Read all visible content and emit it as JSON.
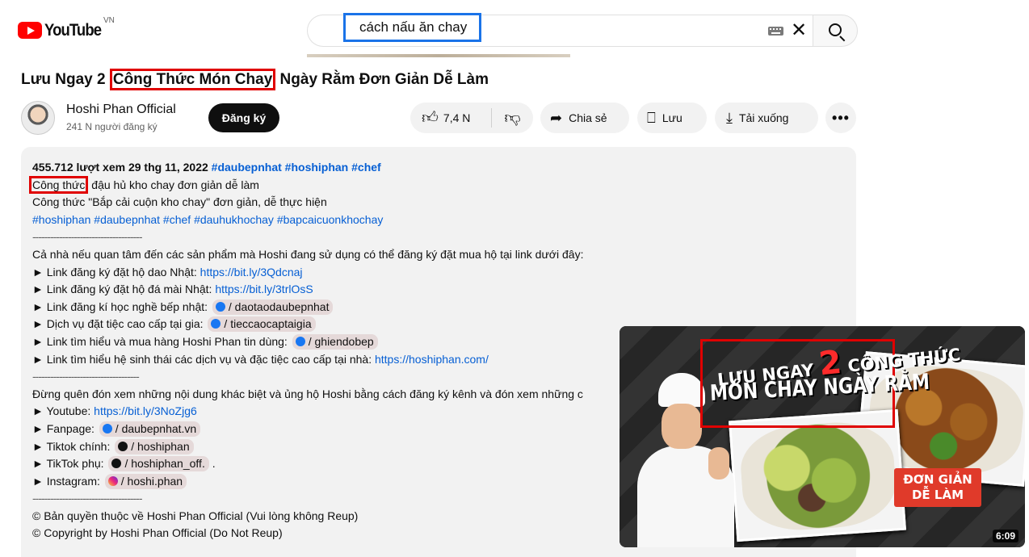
{
  "header": {
    "logo_text": "YouTube",
    "country_code": "VN",
    "search_value": "cách nấu ăn chay"
  },
  "video": {
    "title_prefix": "Lưu Ngay 2 ",
    "title_highlight": "Công Thức Món Chay",
    "title_suffix": " Ngày Rằm Đơn Giản Dễ Làm"
  },
  "channel": {
    "name": "Hoshi Phan Official",
    "subscribers": "241 N người đăng ký",
    "subscribe_label": "Đăng ký"
  },
  "actions": {
    "likes": "7,4 N",
    "share_label": "Chia sẻ",
    "save_label": "Lưu",
    "download_label": "Tải xuống",
    "more_label": "•••"
  },
  "description": {
    "views_date": "455.712 lượt xem  29 thg 11, 2022 ",
    "meta_tags": "#daubepnhat #hoshiphan #chef",
    "line1_highlight": "Công thức",
    "line1_rest": " đậu hủ kho chay đơn giản dễ làm",
    "line2": "Công thức \"Bắp cải cuộn kho chay\" đơn giản, dễ thực hiện",
    "hashtags": "#hoshiphan #daubepnhat #chef #dauhukhochay #bapcaicuonkhochay",
    "separator": "-------------------------------------",
    "intro": "Cả nhà nếu quan tâm đến các sản phẩm mà Hoshi đang sử dụng có thể đăng ký đặt mua hộ tại link dưới đây:",
    "links": [
      {
        "text": "► Link đăng ký đặt hộ dao Nhật: ",
        "url": "https://bit.ly/3Qdcnaj"
      },
      {
        "text": "► Link đăng ký đặt hộ đá mài Nhật: ",
        "url": "https://bit.ly/3trlOsS"
      },
      {
        "text": "► Link đăng kí học nghề bếp nhật: ",
        "chip": "/ daotaodaubepnhat"
      },
      {
        "text": "► Dịch vụ đặt tiệc cao cấp tại gia: ",
        "chip": "/ tieccaocaptaigia"
      },
      {
        "text": "► Link tìm hiểu và mua hàng Hoshi Phan tin dùng: ",
        "chip": "/ ghiendobep"
      },
      {
        "text": "► Link tìm hiểu hệ sinh thái các dịch vụ và đặc tiệc cao cấp tại nhà: ",
        "url": "https://hoshiphan.com/"
      }
    ],
    "separator2": "------------------------------------",
    "outro": "Đừng quên đón xem những nội dung khác biệt và ủng hộ Hoshi bằng cách đăng ký kênh và đón xem những c",
    "socials": [
      {
        "text": "► Youtube: ",
        "url": "https://bit.ly/3NoZjg6"
      },
      {
        "text": "► Fanpage: ",
        "chip": "/ daubepnhat.vn"
      },
      {
        "text": "► Tiktok chính: ",
        "chip": "/ hoshiphan"
      },
      {
        "text": "► TikTok phụ: ",
        "chip": "/ hoshiphan_off.",
        "after": " ."
      },
      {
        "text": "► Instagram: ",
        "chip": "/ hoshi.phan"
      }
    ],
    "separator3": "-------------------------------------",
    "copyright_vi": "© Bản quyền thuộc về Hoshi Phan Official (Vui lòng không Reup)",
    "copyright_en": "© Copyright by Hoshi Phan Official (Do Not Reup)"
  },
  "miniplayer": {
    "title_line1_a": "LƯU NGAY ",
    "title_line1_num": "2",
    "title_line1_b": " CÔNG THỨC",
    "title_line2": "MÓN CHAY NGÀY RẰM",
    "badge_line1": "ĐƠN GIẢN",
    "badge_line2": "DỄ LÀM",
    "duration": "6:09"
  },
  "colors": {
    "accent_red": "#e00000",
    "link_blue": "#065fd4",
    "search_highlight": "#1a73e8"
  }
}
